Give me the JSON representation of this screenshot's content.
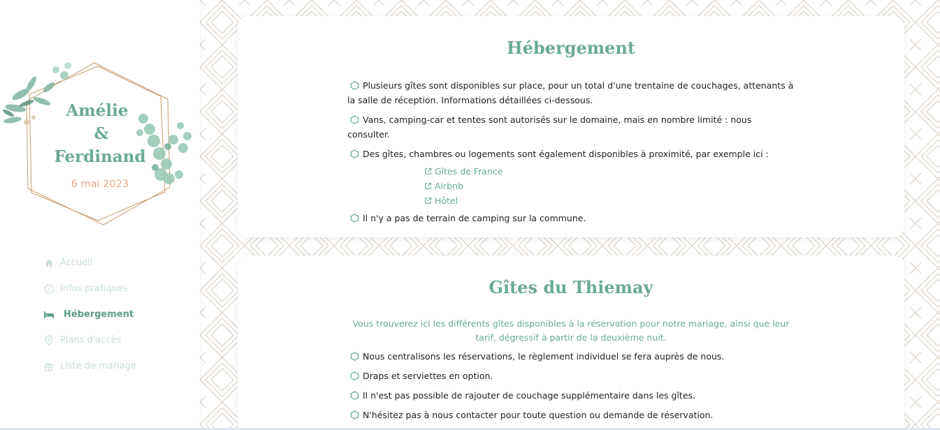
{
  "logo": {
    "name_1": "Amélie",
    "ampersand": "&",
    "name_2": "Ferdinand",
    "date": "6 mai 2023"
  },
  "nav": {
    "items": [
      {
        "label": "Accueil",
        "icon": "home-icon"
      },
      {
        "label": "Infos pratiques",
        "icon": "info-icon"
      },
      {
        "label": "Hébergement",
        "icon": "bed-icon",
        "active": true
      },
      {
        "label": "Plans d'accès",
        "icon": "map-pin-icon"
      },
      {
        "label": "Liste de mariage",
        "icon": "gift-icon"
      }
    ]
  },
  "hebergement": {
    "title": "Hébergement",
    "bullets": [
      "Plusieurs gîtes sont disponibles sur place, pour un total d'une trentaine de couchages, attenants à la salle de réception. Informations détaillées ci-dessous.",
      "Vans, camping-car et tentes sont autorisés sur le domaine, mais en nombre limité : nous consulter.",
      "Des gîtes, chambres ou logements sont également disponibles à proximité, par exemple ici :",
      "Il n'y a pas de terrain de camping sur la commune."
    ],
    "links": [
      "Gîtes de France",
      "Airbnb",
      "Hôtel"
    ]
  },
  "gites": {
    "title": "Gîtes du Thiemay",
    "intro": "Vous trouverez ici les différents gîtes disponibles à la réservation pour notre mariage, ainsi que leur tarif, dégressif à partir de la deuxième nuit.",
    "bullets": [
      "Nous centralisons les réservations, le règlement individuel se fera auprès de nous.",
      "Draps et serviettes en option.",
      "Il n'est pas possible de rajouter de couchage supplémentaire dans les gîtes.",
      "N'hésitez pas à nous contacter pour toute question ou demande de réservation."
    ]
  },
  "colors": {
    "accent": "#6aaa94",
    "date": "#e3a987",
    "nav_inactive": "#c9ddd5",
    "pattern": "#d9cfc3"
  }
}
